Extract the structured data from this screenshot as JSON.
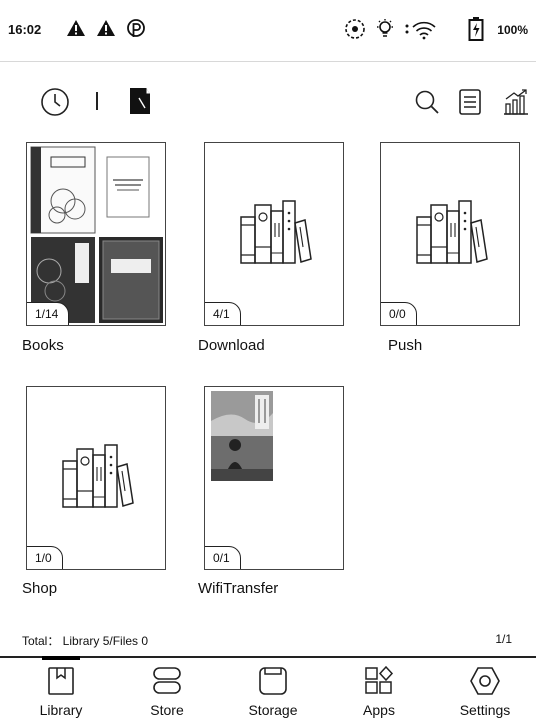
{
  "status_bar": {
    "time": "16:02",
    "battery_percent": "100%"
  },
  "folders": [
    {
      "label": "Books",
      "count": "1/14"
    },
    {
      "label": "Download",
      "count": "4/1"
    },
    {
      "label": "Push",
      "count": "0/0"
    },
    {
      "label": "Shop",
      "count": "1/0"
    },
    {
      "label": "WifiTransfer",
      "count": "0/1"
    }
  ],
  "footer": {
    "total": "Total： Library 5/Files 0",
    "page": "1/1"
  },
  "nav": {
    "items": [
      {
        "label": "Library"
      },
      {
        "label": "Store"
      },
      {
        "label": "Storage"
      },
      {
        "label": "Apps"
      },
      {
        "label": "Settings"
      }
    ]
  }
}
